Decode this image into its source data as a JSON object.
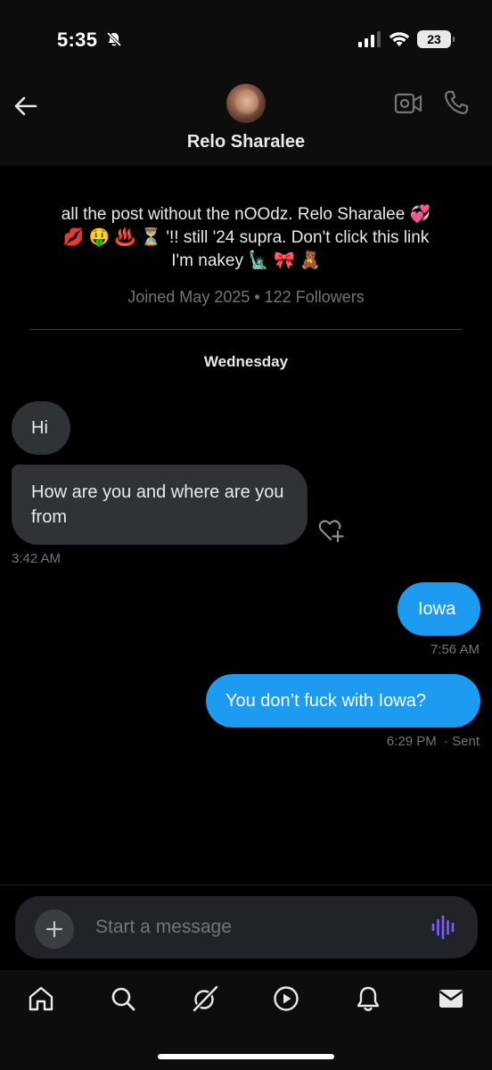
{
  "status_bar": {
    "time": "5:35",
    "battery": "23"
  },
  "header": {
    "contact_name": "Relo Sharalee"
  },
  "profile": {
    "bio_line1": "all the post without the nOOdz. Relo Sharalee 💞",
    "bio_line2": "💋 🤑 ♨️ ⏳ '!! still '24 supra. Don't click this link",
    "bio_line3": "I'm nakey 🗽 🎀 🧸",
    "joined": "Joined May 2025 • 122 Followers"
  },
  "conversation": {
    "day_label": "Wednesday",
    "messages": [
      {
        "text": "Hi"
      },
      {
        "text": "How are you and where are you from",
        "time": "3:42 AM"
      },
      {
        "text": "Iowa",
        "time": "7:56 AM"
      },
      {
        "text": "You don’t fuck with Iowa?",
        "time": "6:29 PM",
        "status": "· Sent"
      }
    ]
  },
  "composer": {
    "placeholder": "Start a message"
  },
  "colors": {
    "outgoing_bubble": "#1d9bf0",
    "incoming_bubble": "#2f3336",
    "voice_accent": "#7b5cff"
  },
  "icons": {
    "back": "arrow-left-icon",
    "video": "video-camera-icon",
    "phone": "phone-icon",
    "react": "heart-plus-icon",
    "plus": "plus-icon",
    "voice": "waveform-icon",
    "nav": [
      "home-icon",
      "search-icon",
      "grok-icon",
      "play-icon",
      "bell-icon",
      "mail-icon"
    ]
  }
}
